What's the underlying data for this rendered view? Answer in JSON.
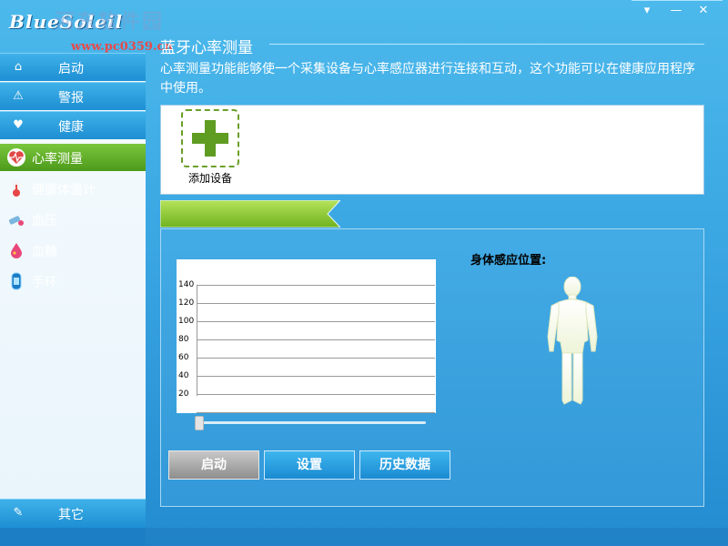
{
  "app": {
    "logo": "BlueSoleil"
  },
  "watermark": {
    "site_name": "河东软件园",
    "url": "www.pc0359.cn"
  },
  "window_controls": {
    "menu": "▾",
    "minimize": "—",
    "close": "✕"
  },
  "sidebar": {
    "categories": [
      {
        "label": "启动",
        "icon": "home-icon"
      },
      {
        "label": "警报",
        "icon": "warning-icon"
      },
      {
        "label": "健康",
        "icon": "heart-icon"
      }
    ],
    "items": [
      {
        "label": "心率测量",
        "icon": "heart-rate-icon",
        "selected": true
      },
      {
        "label": "健康体温计",
        "icon": "thermometer-icon"
      },
      {
        "label": "血压",
        "icon": "blood-pressure-icon"
      },
      {
        "label": "血糖",
        "icon": "blood-sugar-icon"
      },
      {
        "label": "手环",
        "icon": "wristband-icon"
      }
    ],
    "bottom": {
      "label": "其它",
      "icon": "other-icon"
    }
  },
  "main": {
    "title": "蓝牙心率测量",
    "description": "心率测量功能能够使一个采集设备与心率感应器进行连接和互动，这个功能可以在健康应用程序中使用。",
    "add_device_label": "添加设备",
    "body_position_label": "身体感应位置:",
    "buttons": {
      "start": "启动",
      "settings": "设置",
      "history": "历史数据"
    }
  },
  "chart_data": {
    "type": "line",
    "y_ticks": [
      "140",
      "120",
      "100",
      "80",
      "60",
      "40",
      "20"
    ],
    "series": [],
    "ylim": [
      20,
      140
    ],
    "grid": true
  },
  "colors": {
    "accent": "#2a9ee0",
    "selected": "#5ea82a",
    "plus": "#5f9c22"
  }
}
